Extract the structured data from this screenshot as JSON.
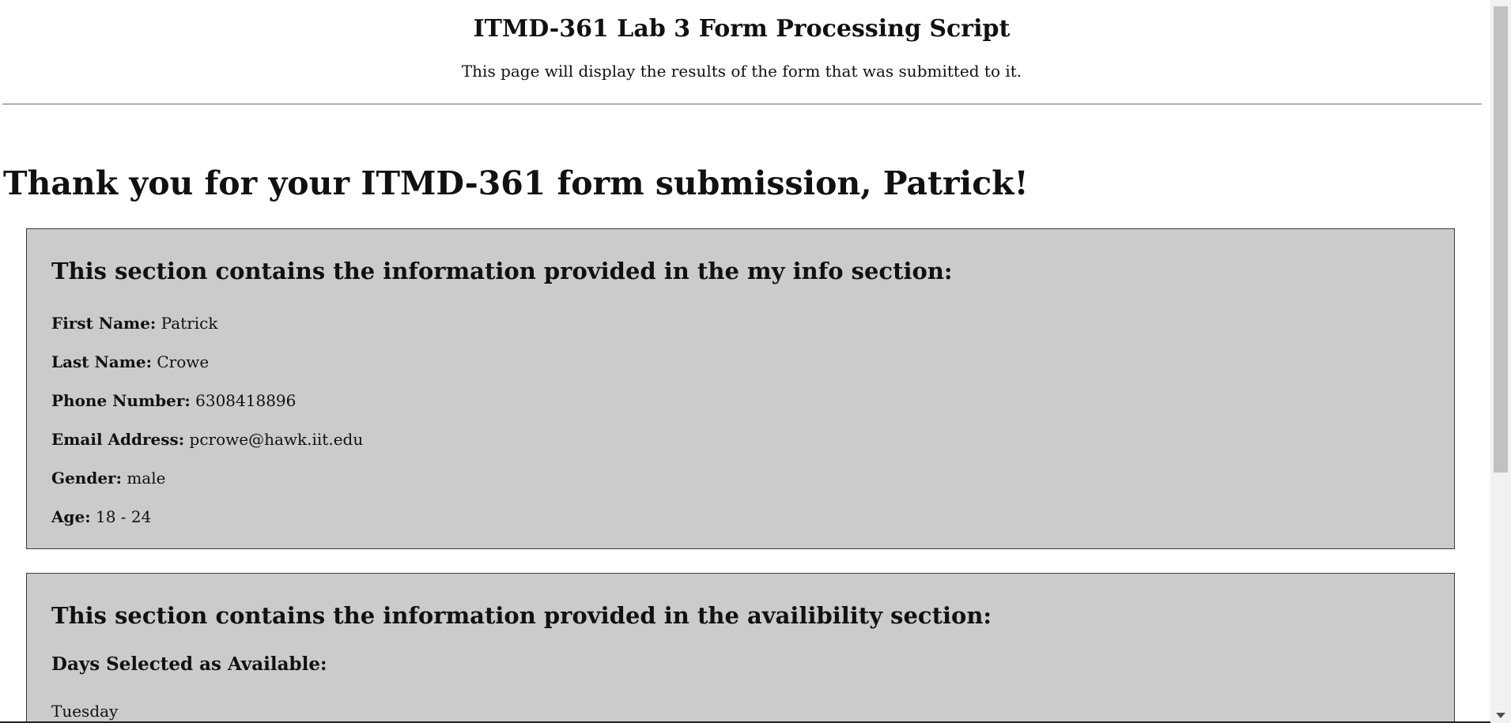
{
  "header": {
    "title": "ITMD-361 Lab 3 Form Processing Script",
    "subtitle": "This page will display the results of the form that was submitted to it."
  },
  "thanks": "Thank you for your ITMD-361 form submission, Patrick!",
  "info_section": {
    "heading": "This section contains the information provided in the my info section:",
    "fields": [
      {
        "label": "First Name:",
        "value": "Patrick"
      },
      {
        "label": "Last Name:",
        "value": "Crowe"
      },
      {
        "label": "Phone Number:",
        "value": "6308418896"
      },
      {
        "label": "Email Address:",
        "value": "pcrowe@hawk.iit.edu"
      },
      {
        "label": "Gender:",
        "value": "male"
      },
      {
        "label": "Age:",
        "value": "18 - 24"
      }
    ]
  },
  "availability_section": {
    "heading": "This section contains the information provided in the availibility section:",
    "days_heading": "Days Selected as Available:",
    "days": [
      "Tuesday"
    ]
  }
}
